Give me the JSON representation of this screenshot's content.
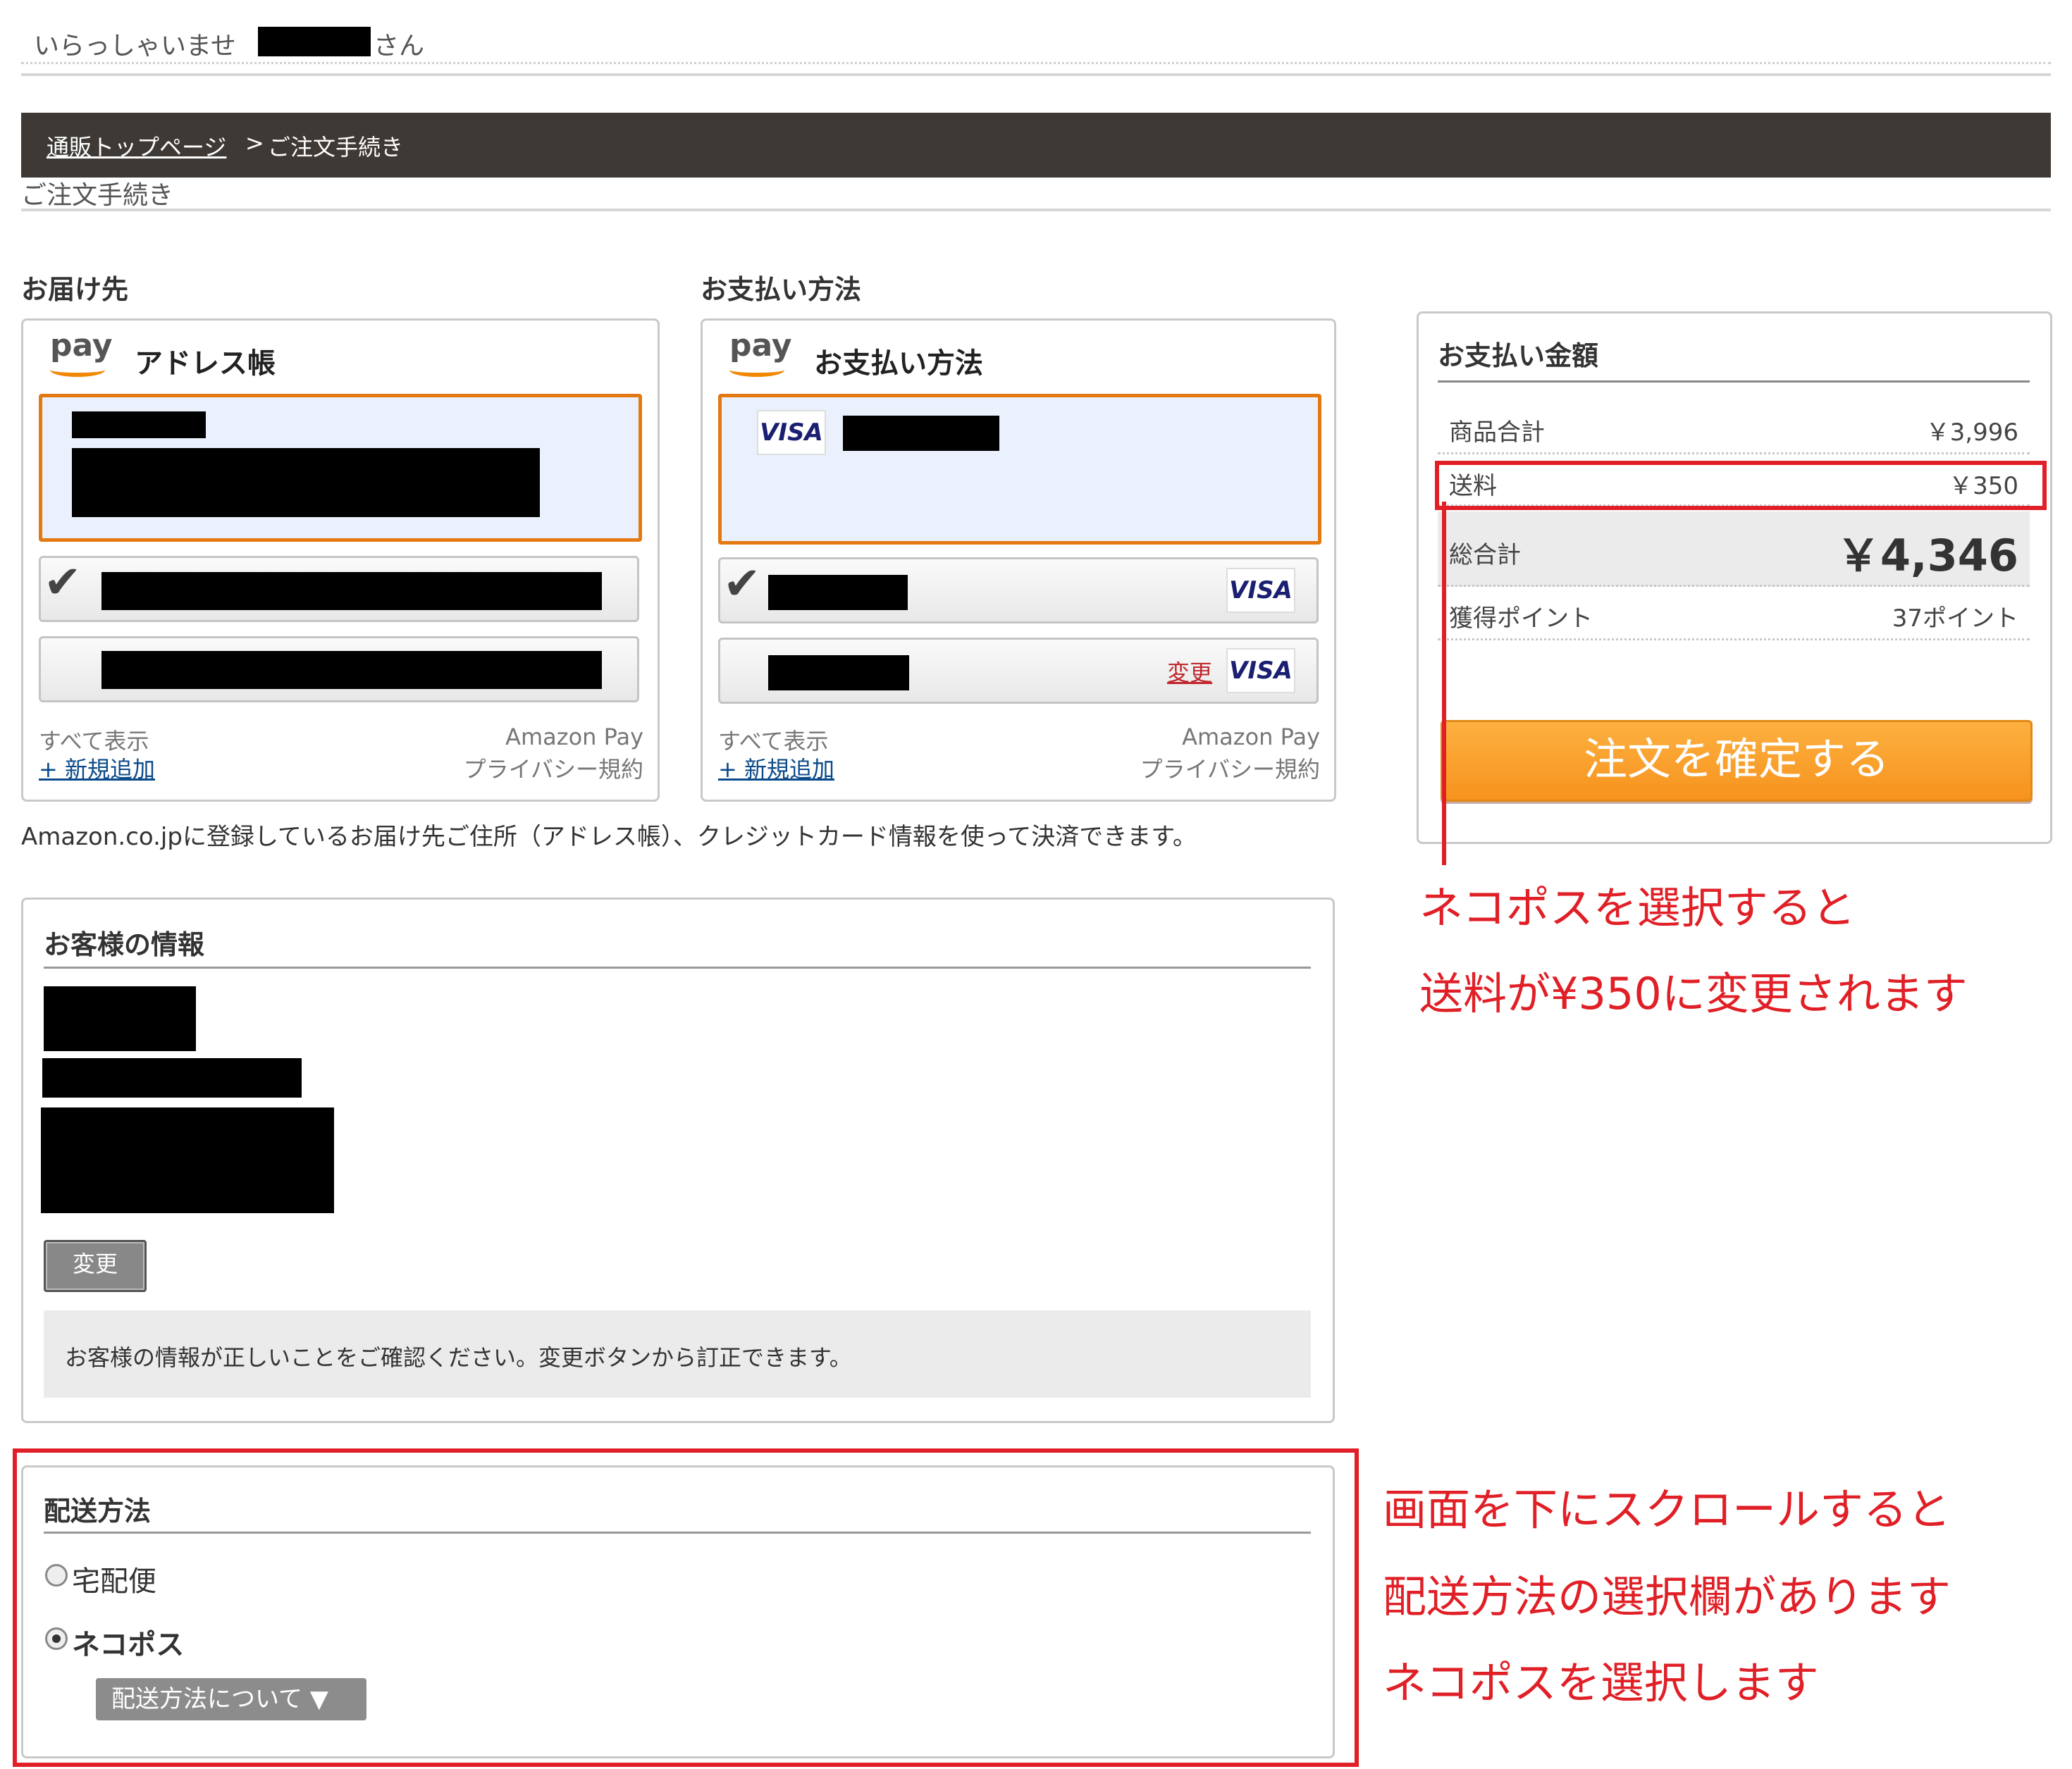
{
  "header": {
    "welcome": "いらっしゃいませ",
    "name_suffix": "さん"
  },
  "breadcrumb": {
    "home": "通販トップページ",
    "separator": ">",
    "current": "ご注文手続き"
  },
  "page_title": "ご注文手続き",
  "shipping": {
    "heading": "お届け先",
    "widget_logo": "pay",
    "widget_title": "アドレス帳",
    "show_all": "すべて表示",
    "add_new": "+ 新規追加",
    "brand": "Amazon Pay",
    "privacy": "プライバシー規約"
  },
  "payment": {
    "heading": "お支払い方法",
    "widget_logo": "pay",
    "widget_title": "お支払い方法",
    "card_brand": "VISA",
    "change_link": "変更",
    "show_all": "すべて表示",
    "add_new": "+ 新規追加",
    "brand": "Amazon Pay",
    "privacy": "プライバシー規約"
  },
  "amazon_note": "Amazon.co.jpに登録しているお届け先ご住所（アドレス帳）、クレジットカード情報を使って決済できます。",
  "customer": {
    "heading": "お客様の情報",
    "change_button": "変更",
    "note": "お客様の情報が正しいことをご確認ください。変更ボタンから訂正できます。"
  },
  "delivery": {
    "heading": "配送方法",
    "options": [
      {
        "label": "宅配便",
        "selected": false
      },
      {
        "label": "ネコポス",
        "selected": true
      }
    ],
    "about_button": "配送方法について ▼"
  },
  "summary": {
    "heading": "お支払い金額",
    "rows": [
      {
        "label": "商品合計",
        "value": "￥3,996"
      },
      {
        "label": "送料",
        "value": "￥350"
      },
      {
        "label": "総合計",
        "value": "￥4,346"
      },
      {
        "label": "獲得ポイント",
        "value": "37ポイント"
      }
    ],
    "confirm_button": "注文を確定する"
  },
  "annotations": {
    "shipping_fee_line1": "ネコポスを選択すると",
    "shipping_fee_line2": "送料が¥350に変更されます",
    "delivery_line1": "画面を下にスクロールすると",
    "delivery_line2": "配送方法の選択欄があります",
    "delivery_line3": "ネコポスを選択します",
    "color": "#e01f26"
  },
  "colors": {
    "breadcrumb_bg": "#3e3935",
    "selection_border": "#e47911",
    "confirm_button": "#f7931e",
    "link": "#0b4a8a"
  }
}
